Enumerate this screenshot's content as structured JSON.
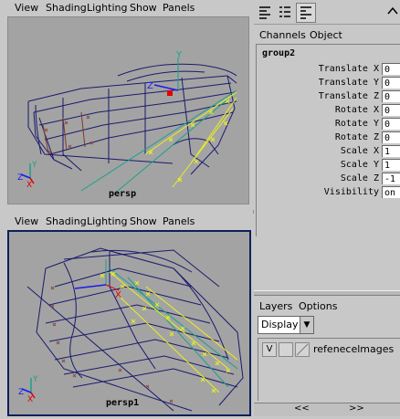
{
  "viewport_menu": {
    "view": "View",
    "shading": "Shading",
    "lighting": "Lighting",
    "show": "Show",
    "panels": "Panels"
  },
  "top_panel": {
    "camera": "persp"
  },
  "bottom_panel": {
    "camera": "persp1"
  },
  "channel_box": {
    "menu_channels": "Channels",
    "menu_object": "Object",
    "object_name": "group2",
    "attributes": [
      {
        "label": "Translate X",
        "value": "0"
      },
      {
        "label": "Translate Y",
        "value": "0"
      },
      {
        "label": "Translate Z",
        "value": "0"
      },
      {
        "label": "Rotate X",
        "value": "0"
      },
      {
        "label": "Rotate Y",
        "value": "0"
      },
      {
        "label": "Rotate Z",
        "value": "0"
      },
      {
        "label": "Scale X",
        "value": "1"
      },
      {
        "label": "Scale Y",
        "value": "1"
      },
      {
        "label": "Scale Z",
        "value": "-1"
      },
      {
        "label": "Visibility",
        "value": "on"
      }
    ]
  },
  "layer_editor": {
    "menu_layers": "Layers",
    "menu_options": "Options",
    "mode_value": "Display",
    "layers": [
      {
        "visible": "V",
        "name": "refenecelmages"
      }
    ]
  },
  "scroll": {
    "left_arrows": "<<",
    "right_arrows": ">>"
  },
  "colors": {
    "viewport_bg": "#a3a3a3",
    "wire": "#1a1a6e",
    "selected": "#e8f020",
    "active_border": "#0e1f5a"
  },
  "icons": [
    "channel-box-icon",
    "attribute-list-icon",
    "layer-editor-icon",
    "expand-icon"
  ]
}
